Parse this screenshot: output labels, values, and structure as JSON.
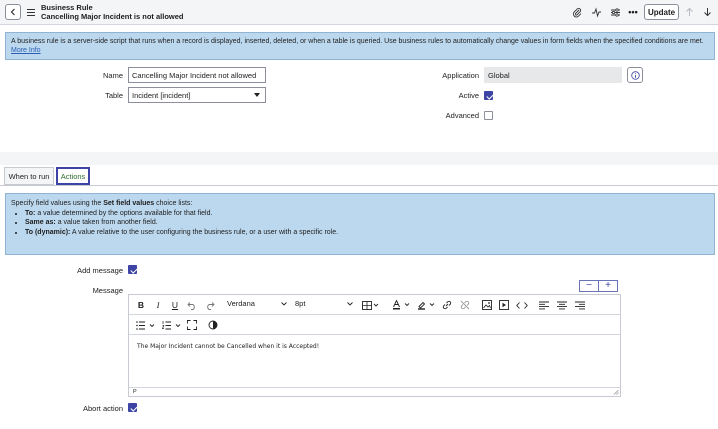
{
  "header": {
    "record_type": "Business Rule",
    "record_name": "Cancelling Major Incident is not allowed",
    "update_label": "Update"
  },
  "info_banner": {
    "text": "A business rule is a server-side script that runs when a record is displayed, inserted, deleted, or when a table is queried. Use business rules to automatically change values in form fields when the specified conditions are met.",
    "more_info": "More Info"
  },
  "form": {
    "name_label": "Name",
    "name_value": "Cancelling Major Incident not allowed",
    "table_label": "Table",
    "table_value": "Incident [incident]",
    "application_label": "Application",
    "application_value": "Global",
    "active_label": "Active",
    "active_checked": true,
    "advanced_label": "Advanced",
    "advanced_checked": false
  },
  "tabs": [
    {
      "label": "When to run",
      "active": false
    },
    {
      "label": "Actions",
      "active": true
    }
  ],
  "actions_info": {
    "intro_prefix": "Specify field values using the ",
    "intro_bold": "Set field values",
    "intro_suffix": " choice lists:",
    "items": [
      {
        "bold": "To:",
        "text": " a value determined by the options available for that field."
      },
      {
        "bold": "Same as:",
        "text": " a value taken from another field."
      },
      {
        "bold": "To (dynamic):",
        "text": " A value relative to the user configuring the business rule, or a user with a specific role."
      }
    ]
  },
  "actions": {
    "add_message_label": "Add message",
    "add_message_checked": true,
    "message_label": "Message",
    "abort_action_label": "Abort action",
    "abort_action_checked": true
  },
  "editor": {
    "font_family": "Verdana",
    "font_size": "8pt",
    "content": "The Major Incident cannot be Cancelled when it is Accepted!",
    "status_path": "P",
    "bold": "B",
    "italic": "I",
    "underline": "U"
  },
  "colors": {
    "accent": "#3d44a5",
    "banner_bg": "#bcd8ee",
    "header_bg": "#f4f5f7"
  }
}
